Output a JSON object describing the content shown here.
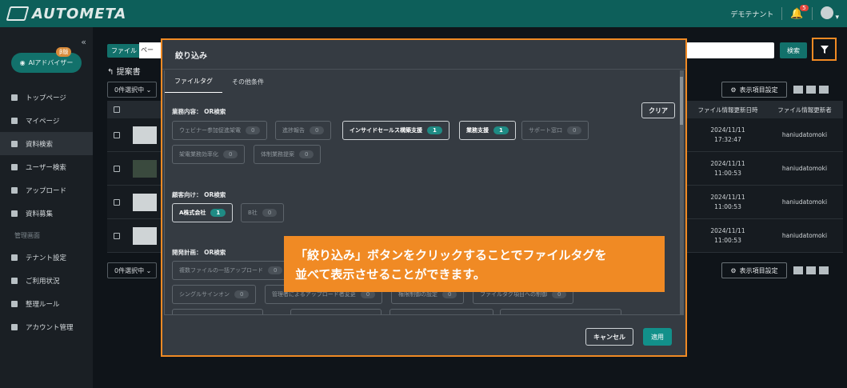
{
  "app": {
    "brand": "AUTOMETA",
    "tenant": "デモテナント",
    "notif_count": "5"
  },
  "sidebar": {
    "collapse": "«",
    "ai_button": "AIアドバイザー",
    "ai_badge": "β版",
    "items": [
      {
        "label": "トップページ"
      },
      {
        "label": "マイページ"
      },
      {
        "label": "資料検索"
      },
      {
        "label": "ユーザー検索"
      },
      {
        "label": "アップロード"
      },
      {
        "label": "資料募集"
      }
    ],
    "admin_section": "管理画面",
    "admin_items": [
      {
        "label": "テナント設定"
      },
      {
        "label": "ご利用状況"
      },
      {
        "label": "整理ルール"
      },
      {
        "label": "アカウント管理"
      }
    ]
  },
  "main": {
    "file_label": "ファイル",
    "file_input": "ペー",
    "search_button": "検索",
    "breadcrumb": "提案書",
    "select_label": "0件選択中",
    "columns_button": "表示項目設定",
    "table": {
      "headers": [
        "ファイル情報更新日時",
        "ファイル情報更新者"
      ],
      "rows": [
        {
          "date": "2024/11/11",
          "time": "17:32:47",
          "user": "haniudatomoki"
        },
        {
          "date": "2024/11/11",
          "time": "11:00:53",
          "user": "haniudatomoki"
        },
        {
          "date": "2024/11/11",
          "time": "11:00:53",
          "user": "haniudatomoki"
        },
        {
          "date": "2024/11/11",
          "time": "11:00:53",
          "user": "haniudatomoki"
        }
      ]
    }
  },
  "modal": {
    "title": "絞り込み",
    "tabs": [
      "ファイルタグ",
      "その他条件"
    ],
    "clear": "クリア",
    "sections": {
      "business": "業務内容： OR検索",
      "customer": "顧客向け： OR検索",
      "dev": "開発計画： OR検索"
    },
    "business_tags": [
      {
        "label": "ウェビナー参加促進架電",
        "count": "0"
      },
      {
        "label": "進捗報告",
        "count": "0"
      },
      {
        "label": "インサイドセールス構築支援",
        "count": "1"
      },
      {
        "label": "業務支援",
        "count": "1"
      },
      {
        "label": "サポート窓口",
        "count": "0"
      },
      {
        "label": "架電業務効率化",
        "count": "0"
      },
      {
        "label": "体制業務提案",
        "count": "0"
      }
    ],
    "customer_tags": [
      {
        "label": "A株式会社",
        "count": "1"
      },
      {
        "label": "B社",
        "count": "0"
      }
    ],
    "dev_tags": [
      {
        "label": "複数ファイルの一括アップロード",
        "count": "0"
      },
      {
        "label": "シングルサインオン",
        "count": "0"
      },
      {
        "label": "管理者によるアップロード者変更",
        "count": "0"
      },
      {
        "label": "権限制御の設定",
        "count": "0"
      },
      {
        "label": "ファイルタグ項目への制御",
        "count": "0"
      }
    ],
    "cancel": "キャンセル",
    "apply": "適用"
  },
  "callout": {
    "line1": "「絞り込み」ボタンをクリックすることでファイルタグを",
    "line2": "並べて表示させることができます。"
  },
  "colors": {
    "accent": "#f08a24",
    "brand": "#0d5f5a",
    "teal": "#12908a"
  }
}
